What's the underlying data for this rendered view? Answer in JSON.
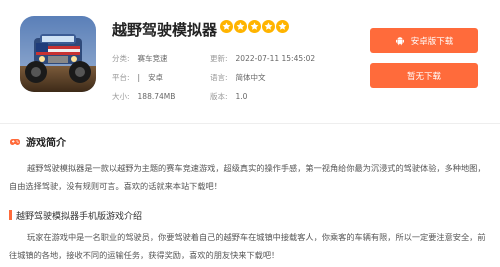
{
  "app": {
    "title": "越野驾驶模拟器",
    "rating": 5,
    "category_label": "分类:",
    "category_value": "赛车竞速",
    "update_label": "更新:",
    "update_value": "2022-07-11 15:45:02",
    "platform_label": "平台:",
    "platform_sep": "|",
    "platform_value": "安卓",
    "language_label": "语言:",
    "language_value": "简体中文",
    "size_label": "大小:",
    "size_value": "188.74MB",
    "version_label": "版本:",
    "version_value": "1.0"
  },
  "buttons": {
    "android_label": "安卓版下载",
    "none_label": "暂无下载"
  },
  "intro": {
    "title": "游戏简介",
    "text": "越野驾驶模拟器是一款以越野为主题的赛车竞速游戏，超级真实的操作手感，第一视角给你最为沉浸式的驾驶体验，多种地图，自由选择驾驶，没有规则可言。喜欢的话就来本站下载吧！"
  },
  "sub_section": {
    "title": "越野驾驶模拟器手机版游戏介绍",
    "text": "玩家在游戏中是一名职业的驾驶员，你要驾驶着自己的越野车在城镇中接载客人，你乘客的车辆有限，所以一定要注意安全，前往城镇的各地，接收不同的运输任务，获得奖励，喜欢的朋友快来下载吧！"
  },
  "colors": {
    "accent": "#ff6b3b",
    "star": "#ffb400"
  },
  "icons": {
    "android": "android-icon",
    "section": "gamepad-icon",
    "star": "star-icon"
  }
}
